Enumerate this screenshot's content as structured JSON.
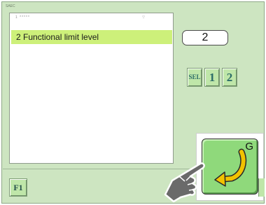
{
  "window": {
    "title": "SAEC"
  },
  "list": {
    "header": "1 *****",
    "header_mark": "▽",
    "items": [
      {
        "label": "2 Functional limit level",
        "selected": true
      }
    ]
  },
  "value_display": {
    "value": "2"
  },
  "keys": {
    "sel": "SEL",
    "one": "1",
    "two": "2"
  },
  "bottom": {
    "f1": "F1"
  },
  "enter_key": {
    "letter": "G",
    "icon": "return-arrow-icon"
  },
  "pointer": {
    "icon": "pointing-hand-icon"
  },
  "colors": {
    "background": "#cde5c1",
    "selection": "#cdf07a",
    "key_face": "#bfe6a9",
    "enter_face": "#8fd97b",
    "arrow": "#f2c200"
  }
}
